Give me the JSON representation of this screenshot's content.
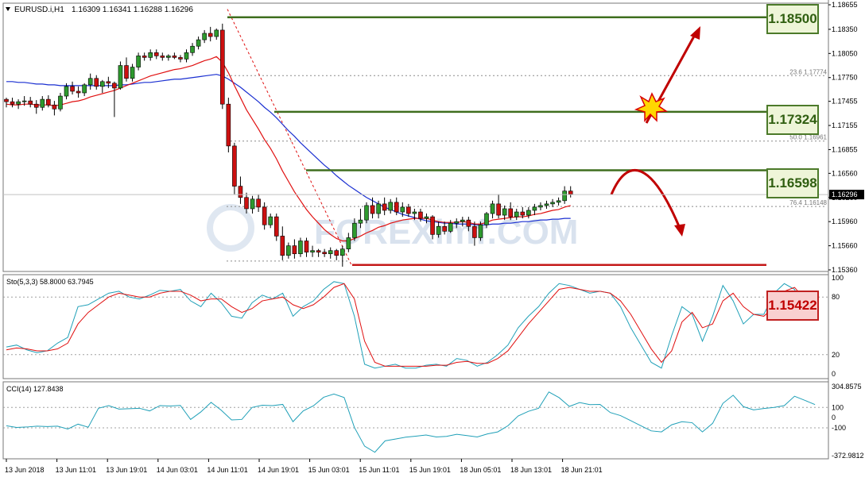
{
  "chart_data": {
    "type": "candlestick",
    "symbol_info": "EURUSD.i,H1",
    "ohlc_info": "1.16309 1.16341 1.16288 1.16296",
    "current_price": "1.16296",
    "price_axis_ticks": [
      "1.18655",
      "1.18350",
      "1.18050",
      "1.17750",
      "1.17455",
      "1.17155",
      "1.16855",
      "1.16560",
      "1.16260",
      "1.15960",
      "1.15660",
      "1.15360"
    ],
    "time_axis_labels": [
      "13 Jun 2018",
      "13 Jun 11:01",
      "13 Jun 19:01",
      "14 Jun 03:01",
      "14 Jun 11:01",
      "14 Jun 19:01",
      "15 Jun 03:01",
      "15 Jun 11:01",
      "15 Jun 19:01",
      "18 Jun 05:01",
      "18 Jun 13:01",
      "18 Jun 21:01"
    ],
    "fib_levels": [
      {
        "label": "23.6 1.17774",
        "price": 1.17774
      },
      {
        "label": "50.0 1.16961",
        "price": 1.16961
      },
      {
        "label": "76.4 1.16148",
        "price": 1.16148
      }
    ],
    "key_levels": [
      {
        "label": "1.18500",
        "price": 1.185,
        "kind": "resistance"
      },
      {
        "label": "1.17324",
        "price": 1.17324,
        "kind": "resistance"
      },
      {
        "label": "1.16598",
        "price": 1.16598,
        "kind": "resistance"
      },
      {
        "label": "1.15422",
        "price": 1.15422,
        "kind": "support"
      }
    ],
    "watermark": "FOREXimf.COM",
    "stoch": {
      "label": "Sto(5,3,3) 58.8000 63.7945",
      "axis_ticks": [
        "100",
        "80",
        "20",
        "0"
      ],
      "main": [
        28,
        30,
        25,
        22,
        24,
        32,
        38,
        70,
        72,
        78,
        84,
        86,
        80,
        78,
        82,
        87,
        86,
        88,
        76,
        70,
        84,
        74,
        60,
        58,
        74,
        82,
        78,
        84,
        60,
        70,
        76,
        88,
        96,
        94,
        60,
        10,
        6,
        8,
        10,
        6,
        6,
        9,
        10,
        8,
        16,
        14,
        8,
        12,
        20,
        30,
        48,
        60,
        70,
        84,
        94,
        92,
        88,
        84,
        86,
        84,
        70,
        48,
        30,
        12,
        6,
        40,
        70,
        62,
        34,
        60,
        92,
        76,
        52,
        62,
        62,
        84,
        94,
        88,
        64,
        58
      ],
      "signal": [
        25,
        27,
        26,
        24,
        24,
        26,
        32,
        52,
        64,
        72,
        80,
        84,
        82,
        80,
        80,
        84,
        86,
        86,
        82,
        76,
        78,
        78,
        70,
        64,
        68,
        76,
        78,
        80,
        72,
        68,
        72,
        80,
        90,
        94,
        78,
        34,
        12,
        8,
        8,
        8,
        8,
        8,
        9,
        9,
        12,
        13,
        11,
        11,
        16,
        24,
        38,
        52,
        64,
        76,
        88,
        90,
        88,
        86,
        86,
        84,
        76,
        62,
        44,
        26,
        12,
        24,
        54,
        64,
        48,
        52,
        76,
        84,
        70,
        62,
        60,
        70,
        86,
        90,
        78,
        66
      ]
    },
    "cci": {
      "label": "CCI(14) 127.8438",
      "axis_ticks": [
        "304.8575",
        "100",
        "0",
        "-100",
        "-372.9812"
      ],
      "values": [
        -80,
        -96,
        -92,
        -84,
        -88,
        -84,
        -112,
        -64,
        -94,
        92,
        118,
        84,
        88,
        92,
        66,
        118,
        114,
        120,
        -18,
        56,
        150,
        72,
        -22,
        -18,
        100,
        122,
        118,
        130,
        -40,
        66,
        116,
        200,
        232,
        198,
        -96,
        -280,
        -340,
        -228,
        -210,
        -192,
        -182,
        -170,
        -190,
        -184,
        -164,
        -176,
        -190,
        -160,
        -140,
        -80,
        16,
        62,
        92,
        252,
        196,
        110,
        148,
        128,
        130,
        50,
        20,
        -30,
        -80,
        -130,
        -140,
        -70,
        -40,
        -50,
        -140,
        -56,
        140,
        220,
        108,
        76,
        90,
        100,
        118,
        210,
        170,
        128
      ]
    },
    "candles": [
      [
        1.1748,
        1.175,
        1.1738,
        1.1745
      ],
      [
        1.1745,
        1.175,
        1.1738,
        1.1742
      ],
      [
        1.1742,
        1.1748,
        1.1736,
        1.1745
      ],
      [
        1.1745,
        1.1752,
        1.174,
        1.1746
      ],
      [
        1.1746,
        1.1751,
        1.1738,
        1.1742
      ],
      [
        1.1742,
        1.1747,
        1.173,
        1.1738
      ],
      [
        1.1738,
        1.1752,
        1.1734,
        1.1748
      ],
      [
        1.1748,
        1.1753,
        1.1738,
        1.1741
      ],
      [
        1.1741,
        1.1746,
        1.1728,
        1.1736
      ],
      [
        1.1736,
        1.1756,
        1.1733,
        1.1752
      ],
      [
        1.1752,
        1.1768,
        1.1748,
        1.1764
      ],
      [
        1.1764,
        1.177,
        1.1754,
        1.1758
      ],
      [
        1.1758,
        1.1764,
        1.175,
        1.1756
      ],
      [
        1.1756,
        1.1768,
        1.1752,
        1.1766
      ],
      [
        1.1766,
        1.178,
        1.176,
        1.1774
      ],
      [
        1.1774,
        1.1778,
        1.176,
        1.1764
      ],
      [
        1.1764,
        1.1772,
        1.1756,
        1.177
      ],
      [
        1.177,
        1.1776,
        1.1762,
        1.1768
      ],
      [
        1.1768,
        1.177,
        1.1726,
        1.1762
      ],
      [
        1.1762,
        1.1795,
        1.176,
        1.179
      ],
      [
        1.179,
        1.18,
        1.177,
        1.1774
      ],
      [
        1.1774,
        1.1792,
        1.177,
        1.1788
      ],
      [
        1.1788,
        1.1806,
        1.1784,
        1.1802
      ],
      [
        1.1802,
        1.1806,
        1.1796,
        1.18
      ],
      [
        1.18,
        1.181,
        1.1796,
        1.1806
      ],
      [
        1.1806,
        1.181,
        1.1798,
        1.1802
      ],
      [
        1.1802,
        1.1806,
        1.1796,
        1.18
      ],
      [
        1.18,
        1.1804,
        1.1796,
        1.1802
      ],
      [
        1.1802,
        1.1806,
        1.1798,
        1.18
      ],
      [
        1.18,
        1.1803,
        1.1794,
        1.1798
      ],
      [
        1.1798,
        1.181,
        1.1794,
        1.1806
      ],
      [
        1.1806,
        1.1818,
        1.1802,
        1.1814
      ],
      [
        1.1814,
        1.1826,
        1.181,
        1.1822
      ],
      [
        1.1822,
        1.1834,
        1.1818,
        1.183
      ],
      [
        1.183,
        1.1838,
        1.182,
        1.1826
      ],
      [
        1.1826,
        1.1836,
        1.1822,
        1.1834
      ],
      [
        1.1834,
        1.1842,
        1.1736,
        1.1742
      ],
      [
        1.1742,
        1.175,
        1.1682,
        1.169
      ],
      [
        1.169,
        1.1694,
        1.163,
        1.164
      ],
      [
        1.164,
        1.1652,
        1.1618,
        1.1626
      ],
      [
        1.1626,
        1.1632,
        1.1606,
        1.1612
      ],
      [
        1.1612,
        1.1628,
        1.1606,
        1.1624
      ],
      [
        1.1624,
        1.163,
        1.1608,
        1.1614
      ],
      [
        1.1614,
        1.162,
        1.1586,
        1.1592
      ],
      [
        1.1592,
        1.1606,
        1.1588,
        1.1602
      ],
      [
        1.1602,
        1.1606,
        1.1572,
        1.1578
      ],
      [
        1.1578,
        1.159,
        1.1548,
        1.1554
      ],
      [
        1.1554,
        1.157,
        1.155,
        1.1566
      ],
      [
        1.1566,
        1.1574,
        1.155,
        1.1556
      ],
      [
        1.1556,
        1.1576,
        1.1552,
        1.1572
      ],
      [
        1.1572,
        1.1576,
        1.1552,
        1.1558
      ],
      [
        1.1558,
        1.1566,
        1.1552,
        1.156
      ],
      [
        1.156,
        1.1562,
        1.1552,
        1.1558
      ],
      [
        1.1558,
        1.1562,
        1.1552,
        1.1556
      ],
      [
        1.1556,
        1.1564,
        1.155,
        1.156
      ],
      [
        1.156,
        1.1562,
        1.1548,
        1.1554
      ],
      [
        1.1554,
        1.1566,
        1.154,
        1.1562
      ],
      [
        1.1562,
        1.1582,
        1.1558,
        1.1576
      ],
      [
        1.1576,
        1.16,
        1.1572,
        1.1594
      ],
      [
        1.1594,
        1.1612,
        1.1588,
        1.1598
      ],
      [
        1.1598,
        1.162,
        1.1594,
        1.1616
      ],
      [
        1.1616,
        1.1626,
        1.16,
        1.1606
      ],
      [
        1.1606,
        1.1622,
        1.16,
        1.1618
      ],
      [
        1.1618,
        1.1626,
        1.1604,
        1.161
      ],
      [
        1.161,
        1.1624,
        1.1606,
        1.162
      ],
      [
        1.162,
        1.1626,
        1.1604,
        1.1608
      ],
      [
        1.1608,
        1.162,
        1.1602,
        1.1614
      ],
      [
        1.1614,
        1.1618,
        1.1602,
        1.1606
      ],
      [
        1.1606,
        1.1612,
        1.1598,
        1.1608
      ],
      [
        1.1608,
        1.1612,
        1.1596,
        1.16
      ],
      [
        1.16,
        1.1606,
        1.1594,
        1.1602
      ],
      [
        1.1602,
        1.1604,
        1.1574,
        1.158
      ],
      [
        1.158,
        1.1596,
        1.1576,
        1.159
      ],
      [
        1.159,
        1.1596,
        1.158,
        1.1584
      ],
      [
        1.1584,
        1.1598,
        1.1582,
        1.1594
      ],
      [
        1.1594,
        1.16,
        1.1588,
        1.1596
      ],
      [
        1.1596,
        1.1602,
        1.159,
        1.1598
      ],
      [
        1.1598,
        1.1602,
        1.1584,
        1.159
      ],
      [
        1.159,
        1.1596,
        1.1566,
        1.1576
      ],
      [
        1.1576,
        1.1596,
        1.1572,
        1.1592
      ],
      [
        1.1592,
        1.1608,
        1.1588,
        1.1606
      ],
      [
        1.1606,
        1.1622,
        1.16,
        1.1618
      ],
      [
        1.1618,
        1.163,
        1.16,
        1.1604
      ],
      [
        1.1604,
        1.1616,
        1.1598,
        1.1612
      ],
      [
        1.1612,
        1.162,
        1.1598,
        1.1602
      ],
      [
        1.1602,
        1.1612,
        1.1598,
        1.1608
      ],
      [
        1.1608,
        1.1614,
        1.16,
        1.1604
      ],
      [
        1.1604,
        1.1614,
        1.16,
        1.161
      ],
      [
        1.161,
        1.1618,
        1.1604,
        1.1614
      ],
      [
        1.1614,
        1.162,
        1.161,
        1.1616
      ],
      [
        1.1616,
        1.1622,
        1.1612,
        1.1618
      ],
      [
        1.1618,
        1.1624,
        1.1614,
        1.162
      ],
      [
        1.162,
        1.1626,
        1.1616,
        1.1622
      ],
      [
        1.1622,
        1.164,
        1.1618,
        1.1634
      ],
      [
        1.1634,
        1.164,
        1.1626,
        1.163
      ]
    ],
    "ema_fast": [
      1.1742,
      1.1741,
      1.1741,
      1.1742,
      1.1742,
      1.1741,
      1.1741,
      1.1741,
      1.174,
      1.1741,
      1.1743,
      1.1745,
      1.1746,
      1.1748,
      1.1751,
      1.1753,
      1.1755,
      1.1757,
      1.1759,
      1.1762,
      1.1765,
      1.1768,
      1.1771,
      1.1774,
      1.1777,
      1.1779,
      1.1781,
      1.1783,
      1.1785,
      1.1786,
      1.1788,
      1.179,
      1.1793,
      1.1796,
      1.1798,
      1.1801,
      1.1794,
      1.1781,
      1.1765,
      1.175,
      1.1735,
      1.1723,
      1.1711,
      1.1698,
      1.1687,
      1.1674,
      1.1659,
      1.1646,
      1.1633,
      1.1622,
      1.1611,
      1.1602,
      1.1594,
      1.1586,
      1.158,
      1.1575,
      1.1572,
      1.1572,
      1.1575,
      1.1578,
      1.1582,
      1.1585,
      1.1589,
      1.1591,
      1.1594,
      1.1596,
      1.1598,
      1.1599,
      1.16,
      1.16,
      1.16,
      1.1598,
      1.1596,
      1.1595,
      1.1595,
      1.1595,
      1.1596,
      1.1595,
      1.1593,
      1.1593,
      1.1595,
      1.1598,
      1.1599,
      1.16,
      1.1601,
      1.1602,
      1.1602,
      1.1603,
      1.1605,
      1.1606,
      1.1608,
      1.161,
      1.1611,
      1.1614,
      1.1616
    ],
    "sma_slow": [
      1.177,
      1.177,
      1.1769,
      1.1769,
      1.1768,
      1.1767,
      1.1767,
      1.1766,
      1.1766,
      1.1765,
      1.1765,
      1.1765,
      1.1765,
      1.1765,
      1.1765,
      1.1765,
      1.1765,
      1.1765,
      1.1765,
      1.1766,
      1.1766,
      1.1767,
      1.1768,
      1.1769,
      1.1769,
      1.177,
      1.1771,
      1.1772,
      1.1773,
      1.1773,
      1.1774,
      1.1775,
      1.1776,
      1.1777,
      1.1778,
      1.1779,
      1.1777,
      1.1773,
      1.1768,
      1.1763,
      1.1757,
      1.1751,
      1.1745,
      1.1738,
      1.1732,
      1.1725,
      1.1717,
      1.1709,
      1.1702,
      1.1694,
      1.1687,
      1.168,
      1.1673,
      1.1666,
      1.166,
      1.1653,
      1.1647,
      1.1641,
      1.1636,
      1.1631,
      1.1626,
      1.1622,
      1.1618,
      1.1614,
      1.1611,
      1.1608,
      1.1605,
      1.1603,
      1.1601,
      1.1599,
      1.1597,
      1.1596,
      1.1595,
      1.1594,
      1.1594,
      1.1593,
      1.1593,
      1.1593,
      1.1592,
      1.1592,
      1.1592,
      1.1593,
      1.1593,
      1.1594,
      1.1594,
      1.1595,
      1.1596,
      1.1596,
      1.1597,
      1.1598,
      1.1598,
      1.1599,
      1.1599,
      1.16,
      1.16
    ]
  }
}
